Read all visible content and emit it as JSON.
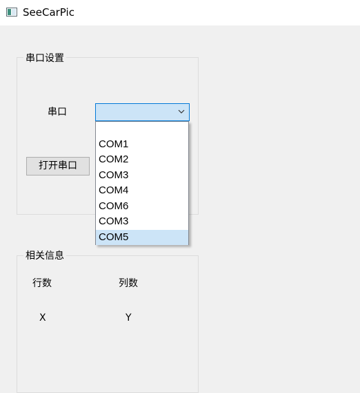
{
  "window": {
    "title": "SeeCarPic",
    "icon": "app-window-icon"
  },
  "serial_group": {
    "legend": "串口设置",
    "port_label": "串口",
    "port_value": "",
    "open_button": "打开串口",
    "dropdown_options": [
      "",
      "COM1",
      "COM2",
      "COM3",
      "COM4",
      "COM6",
      "COM3",
      "COM5"
    ],
    "selected_option": "COM5"
  },
  "info_group": {
    "legend": "相关信息",
    "rows_label": "行数",
    "cols_label": "列数",
    "x_value": "X",
    "y_value": "Y"
  },
  "colors": {
    "selection": "#cce4f7",
    "focus_border": "#0078d7",
    "window_bg": "#f0f0f0"
  }
}
